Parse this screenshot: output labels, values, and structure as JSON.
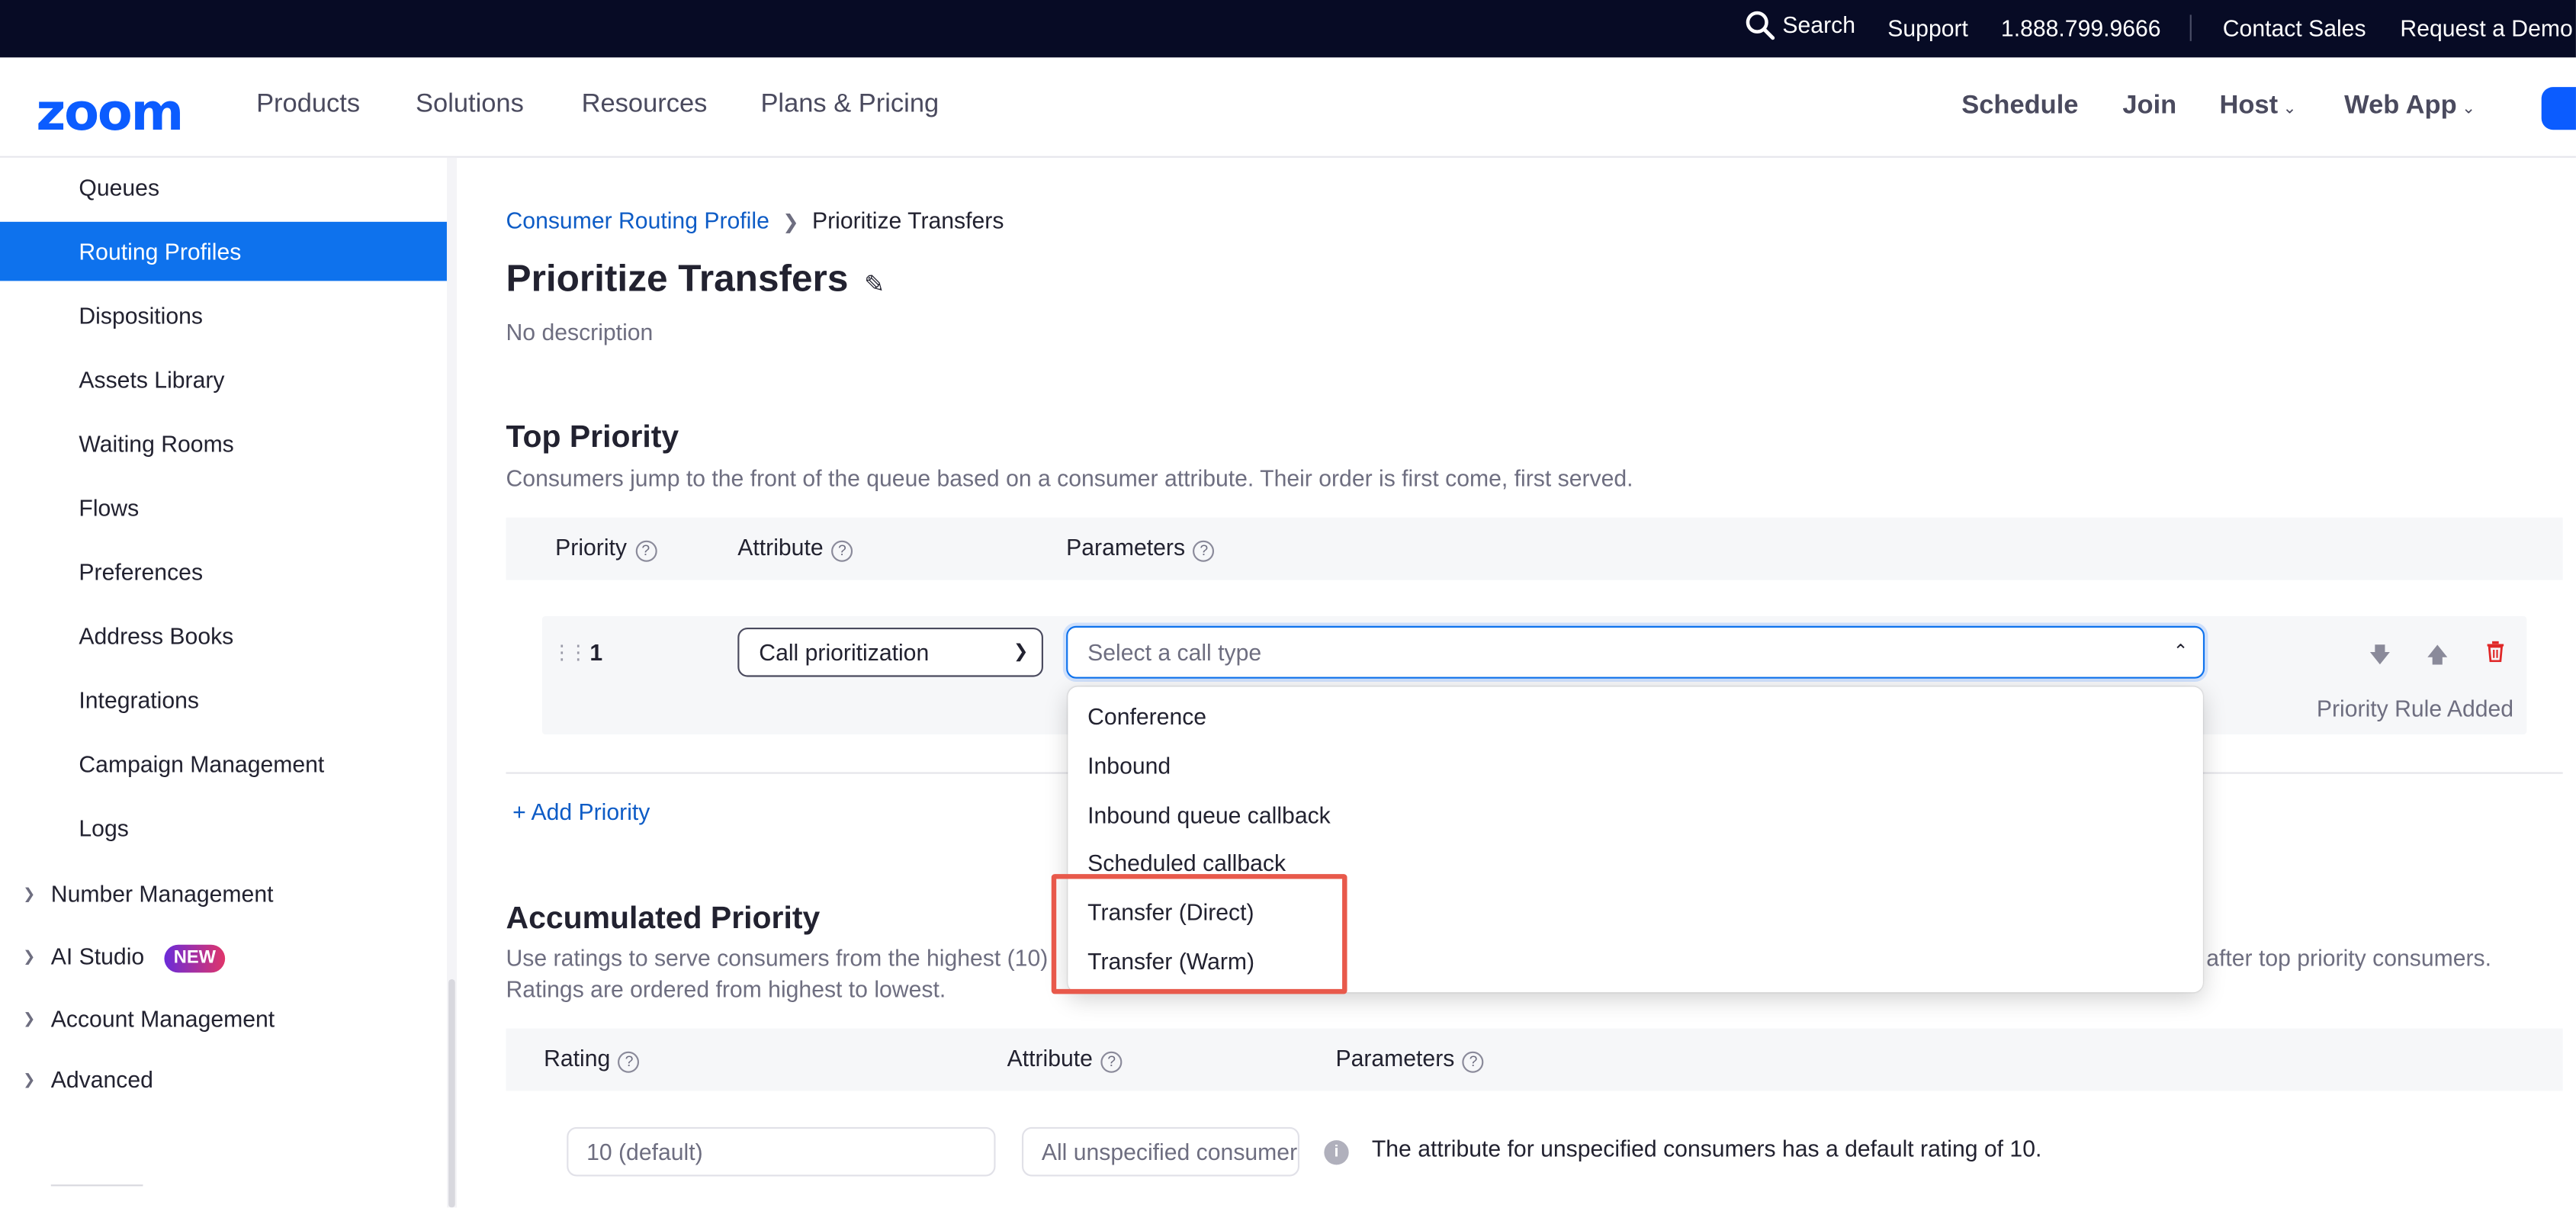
{
  "utility_bar": {
    "search": "Search",
    "support": "Support",
    "phone": "1.888.799.9666",
    "contact_sales": "Contact Sales",
    "request_demo": "Request a Demo"
  },
  "nav": {
    "logo": "zoom",
    "left": [
      "Products",
      "Solutions",
      "Resources",
      "Plans & Pricing"
    ],
    "schedule": "Schedule",
    "join": "Join",
    "host": "Host",
    "web_app": "Web App"
  },
  "sidebar": {
    "items": [
      "Queues",
      "Routing Profiles",
      "Dispositions",
      "Assets Library",
      "Waiting Rooms",
      "Flows",
      "Preferences",
      "Address Books",
      "Integrations",
      "Campaign Management",
      "Logs"
    ],
    "active_item": "Routing Profiles",
    "groups": [
      "Number Management",
      "AI Studio",
      "Account Management",
      "Advanced"
    ],
    "new_badge": "NEW"
  },
  "breadcrumb": {
    "parent": "Consumer Routing Profile",
    "current": "Prioritize Transfers"
  },
  "page": {
    "title": "Prioritize Transfers",
    "description": "No description"
  },
  "top_priority": {
    "title": "Top Priority",
    "description": "Consumers jump to the front of the queue based on a consumer attribute. Their order is first come, first served.",
    "headers": {
      "priority": "Priority",
      "attribute": "Attribute",
      "parameters": "Parameters"
    },
    "row": {
      "number": "1",
      "attribute": "Call prioritization",
      "parameter_placeholder": "Select a call type",
      "status": "Priority Rule Added"
    },
    "add_label": "+ Add Priority"
  },
  "dropdown_options": [
    "Conference",
    "Inbound",
    "Inbound queue callback",
    "Scheduled callback",
    "Transfer (Direct)",
    "Transfer (Warm)"
  ],
  "accumulated_priority": {
    "title": "Accumulated Priority",
    "desc_left": "Use ratings to serve consumers from the highest (10",
    "desc_hidden_fragment": ")",
    "desc_right": "after top priority consumers.",
    "desc_line2": "Ratings are ordered from highest to lowest.",
    "headers": {
      "rating": "Rating",
      "attribute": "Attribute",
      "parameters": "Parameters"
    },
    "row": {
      "rating": "10 (default)",
      "attribute": "All unspecified consumers",
      "info": "The attribute for unspecified consumers has a default rating of 10."
    }
  },
  "colors": {
    "utility_bg": "#070b25",
    "brand_blue": "#0b5cff",
    "active_bg": "#0e72ed",
    "link": "#0e5cc6",
    "highlight": "#e8594b",
    "delete": "#e02828"
  }
}
